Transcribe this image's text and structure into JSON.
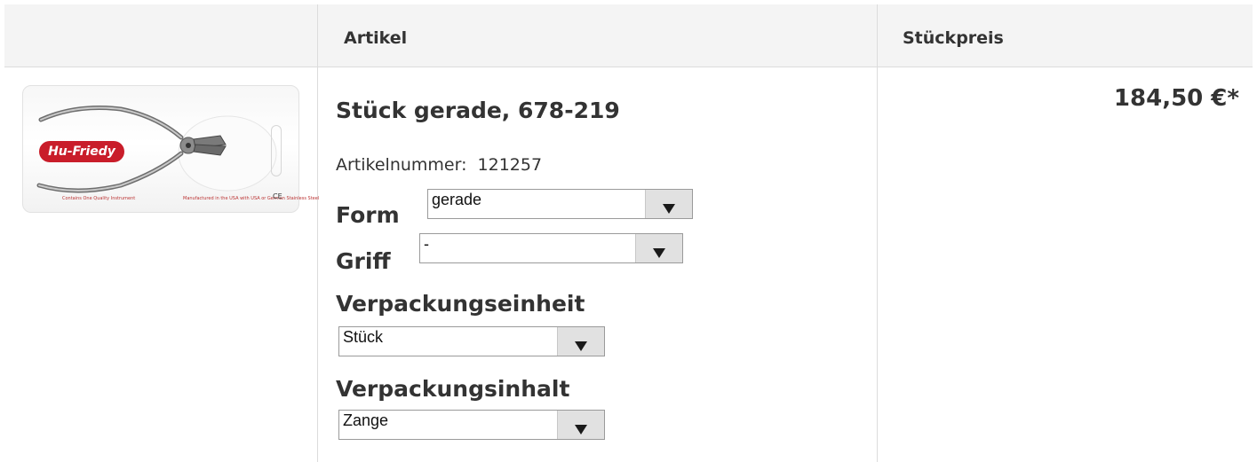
{
  "table": {
    "headers": {
      "image": "",
      "article": "Artikel",
      "unit_price": "Stückpreis"
    }
  },
  "product": {
    "image": {
      "logo_text": "Hu-Friedy",
      "fineprint_left": "Contains One Quality Instrument",
      "fineprint_right": "Manufactured in the USA with USA or German Stainless Steel",
      "mark": "CE"
    },
    "title": "Stück gerade, 678-219",
    "article_number_label": "Artikelnummer:",
    "article_number": "121257",
    "options": [
      {
        "label": "Form",
        "value": "gerade"
      },
      {
        "label": "Griff",
        "value": "-"
      },
      {
        "label": "Verpackungseinheit",
        "value": "Stück"
      },
      {
        "label": "Verpackungsinhalt",
        "value": "Zange"
      }
    ],
    "price": "184,50 €*"
  },
  "colors": {
    "header_bg": "#f4f4f4",
    "border": "#dcdcdc",
    "brand_red": "#c91d2a",
    "dropdown_btn": "#e1e1e1"
  }
}
